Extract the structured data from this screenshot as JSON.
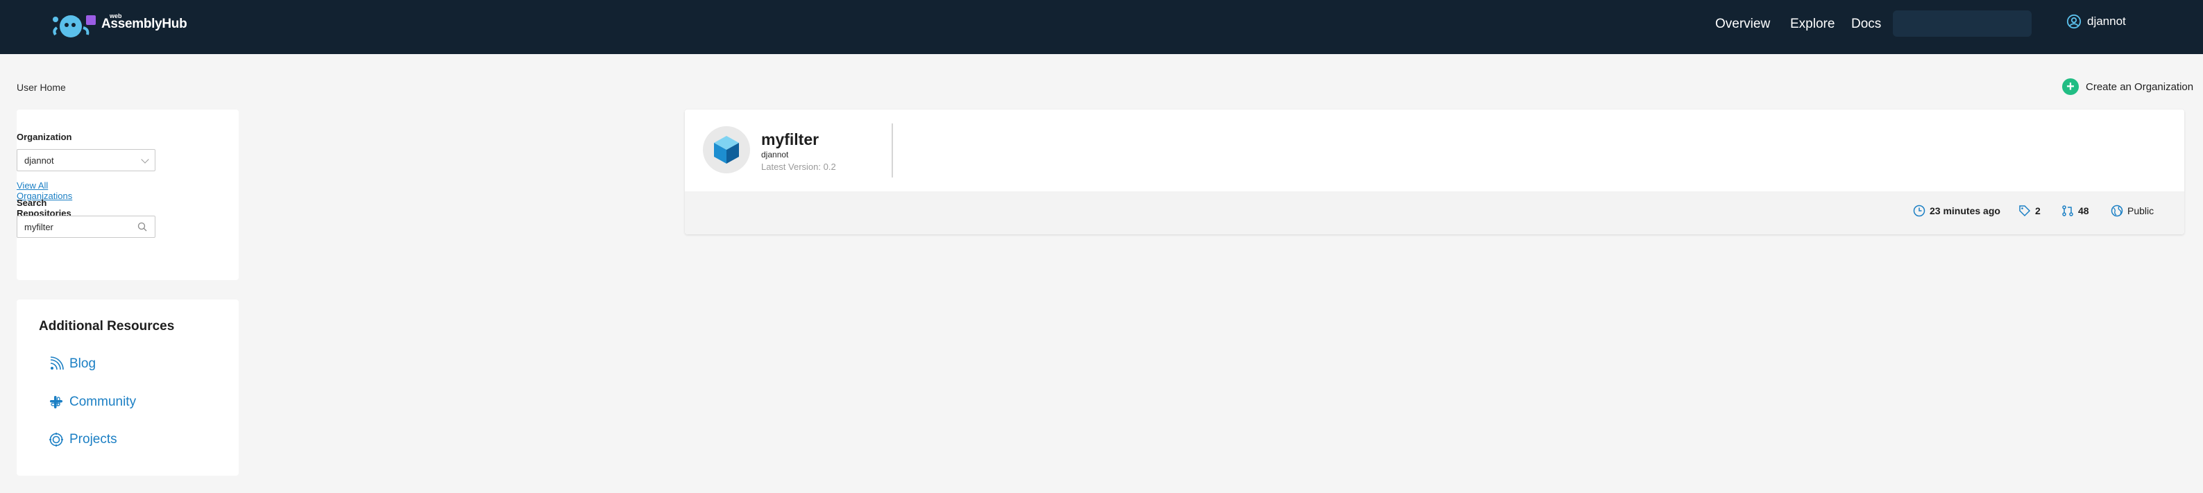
{
  "header": {
    "logo_text": "AssemblyHub",
    "logo_prefix": "web",
    "nav": [
      "Overview",
      "Explore",
      "Docs"
    ],
    "username": "djannot"
  },
  "breadcrumb": "User Home",
  "create_org_label": "Create an Organization",
  "filters": {
    "organization_label": "Organization",
    "organization_value": "djannot",
    "view_all_link": "View All Organizations",
    "search_label": "Search Repositories",
    "search_value": "myfilter"
  },
  "resources": {
    "title": "Additional Resources",
    "items": [
      {
        "label": "Blog",
        "icon": "rss-icon"
      },
      {
        "label": "Community",
        "icon": "slack-icon"
      },
      {
        "label": "Projects",
        "icon": "projects-icon"
      }
    ]
  },
  "repository": {
    "name": "myfilter",
    "owner": "djannot",
    "version": "Latest Version: 0.2",
    "updated": "23 minutes ago",
    "tags": "2",
    "downloads": "48",
    "visibility": "Public"
  },
  "colors": {
    "header_bg": "#122231",
    "accent_blue": "#1b7fc4",
    "create_green": "#21bd84",
    "page_bg": "#f5f5f5"
  }
}
